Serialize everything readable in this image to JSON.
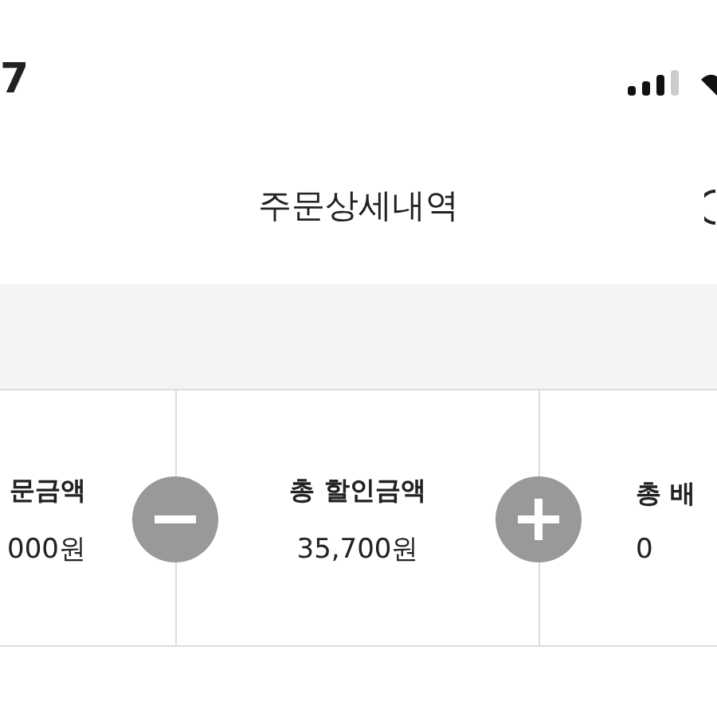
{
  "status_bar": {
    "time": "7"
  },
  "header": {
    "title": "주문상세내역"
  },
  "summary": {
    "cells": [
      {
        "label": "문금액",
        "value": "000원"
      },
      {
        "label": "총 할인금액",
        "value": "35,700원"
      },
      {
        "label": "총 배",
        "value": "0"
      }
    ],
    "operators": [
      {
        "kind": "minus"
      },
      {
        "kind": "plus"
      }
    ]
  }
}
